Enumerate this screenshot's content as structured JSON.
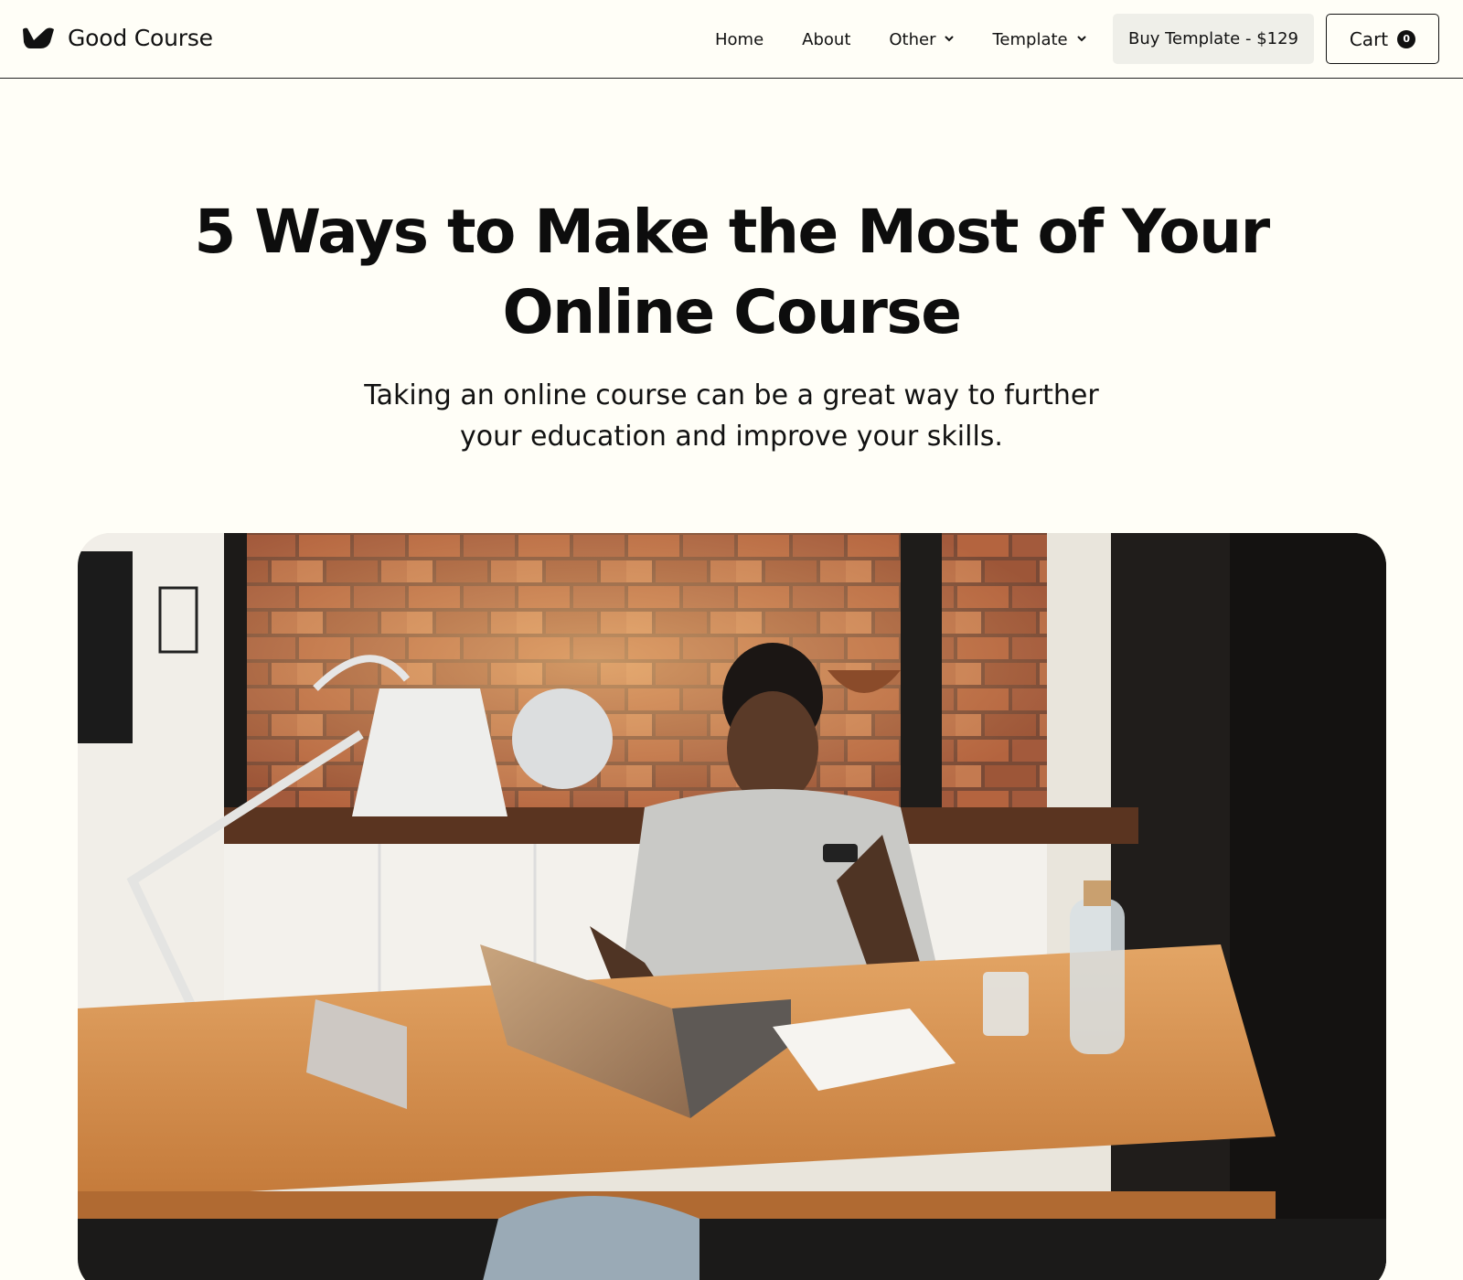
{
  "header": {
    "brand": "Good Course",
    "nav": [
      {
        "label": "Home",
        "has_dropdown": false
      },
      {
        "label": "About",
        "has_dropdown": false
      },
      {
        "label": "Other",
        "has_dropdown": true
      },
      {
        "label": "Template",
        "has_dropdown": true
      }
    ],
    "buy_label": "Buy Template - $129",
    "cart_label": "Cart",
    "cart_count": "0"
  },
  "hero": {
    "title_line1": "5 Ways to Make the Most of Your",
    "title_line2": "Online Course",
    "subtitle_line1": "Taking an online course can be a great way to further",
    "subtitle_line2": "your education and improve your skills."
  },
  "colors": {
    "background": "#fffef7",
    "text": "#111111",
    "button_bg": "#efefe9",
    "accent": "#111111"
  },
  "icons": {
    "logo": "brand-logo-icon",
    "dropdown": "chevron-down-icon"
  }
}
